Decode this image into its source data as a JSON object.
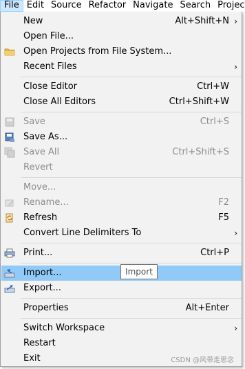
{
  "menubar": {
    "items": [
      "File",
      "Edit",
      "Source",
      "Refactor",
      "Navigate",
      "Search",
      "Project"
    ]
  },
  "menu": {
    "items": [
      {
        "label": "New",
        "accelerator": "Alt+Shift+N",
        "submenu_arrow": "›"
      },
      {
        "label": "Open File..."
      },
      {
        "label": "Open Projects from File System...",
        "icon": "folder-icon"
      },
      {
        "label": "Recent Files",
        "submenu_arrow": "›"
      },
      {
        "label": "Close Editor",
        "accelerator": "Ctrl+W"
      },
      {
        "label": "Close All Editors",
        "accelerator": "Ctrl+Shift+W"
      },
      {
        "label": "Save",
        "accelerator": "Ctrl+S",
        "disabled": true,
        "icon": "save-icon"
      },
      {
        "label": "Save As...",
        "icon": "save-as-icon"
      },
      {
        "label": "Save All",
        "accelerator": "Ctrl+Shift+S",
        "disabled": true,
        "icon": "save-all-icon"
      },
      {
        "label": "Revert",
        "disabled": true
      },
      {
        "label": "Move...",
        "disabled": true
      },
      {
        "label": "Rename...",
        "accelerator": "F2",
        "disabled": true,
        "icon": "rename-icon"
      },
      {
        "label": "Refresh",
        "accelerator": "F5",
        "icon": "refresh-icon"
      },
      {
        "label": "Convert Line Delimiters To",
        "submenu_arrow": "›"
      },
      {
        "label": "Print...",
        "accelerator": "Ctrl+P",
        "icon": "print-icon"
      },
      {
        "label": "Import...",
        "highlighted": true,
        "icon": "import-icon"
      },
      {
        "label": "Export...",
        "icon": "export-icon"
      },
      {
        "label": "Properties",
        "accelerator": "Alt+Enter"
      },
      {
        "label": "Switch Workspace",
        "submenu_arrow": "›"
      },
      {
        "label": "Restart"
      },
      {
        "label": "Exit"
      }
    ]
  },
  "tooltip": {
    "text": "Import"
  },
  "watermark": {
    "text": "CSDN @风带走思念"
  },
  "colors": {
    "highlight": "#91c9f7",
    "menu_bg": "#f2f2f2",
    "disabled_text": "#8d8d8d"
  }
}
